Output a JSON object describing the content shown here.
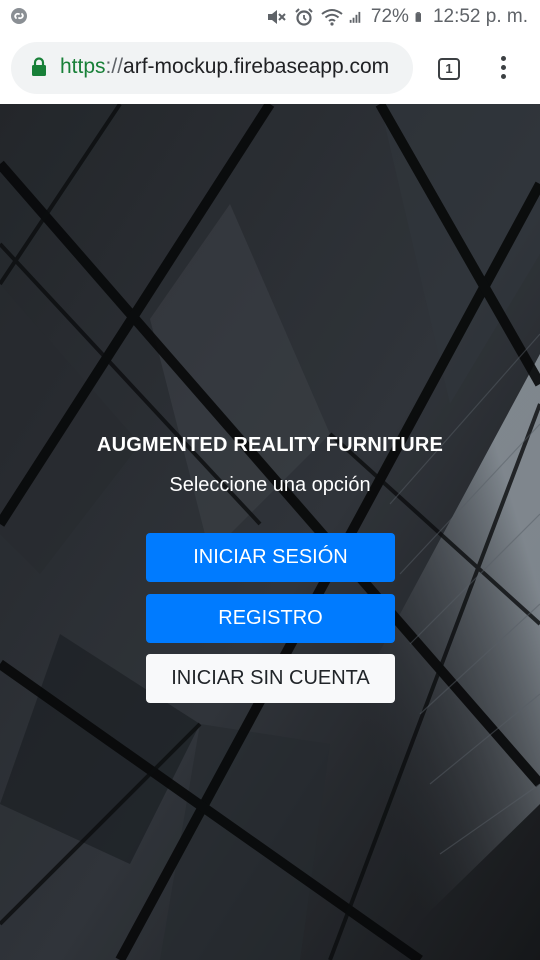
{
  "status_bar": {
    "battery": "72%",
    "time": "12:52 p. m.",
    "icons": [
      "shazam-icon",
      "mute-icon",
      "alarm-icon",
      "wifi-icon",
      "signal-icon",
      "battery-icon"
    ]
  },
  "browser": {
    "url_scheme": "https",
    "url_sep": "://",
    "url_host": "arf-mockup.firebaseapp.com",
    "tab_count": "1",
    "secure_color": "#188038"
  },
  "main": {
    "title": "AUGMENTED REALITY FURNITURE",
    "subtitle": "Seleccione una opción",
    "buttons": {
      "login": "INICIAR SESIÓN",
      "register": "REGISTRO",
      "guest": "INICIAR SIN CUENTA"
    },
    "primary_color": "#007bff",
    "light_color": "#f8f9fa"
  }
}
